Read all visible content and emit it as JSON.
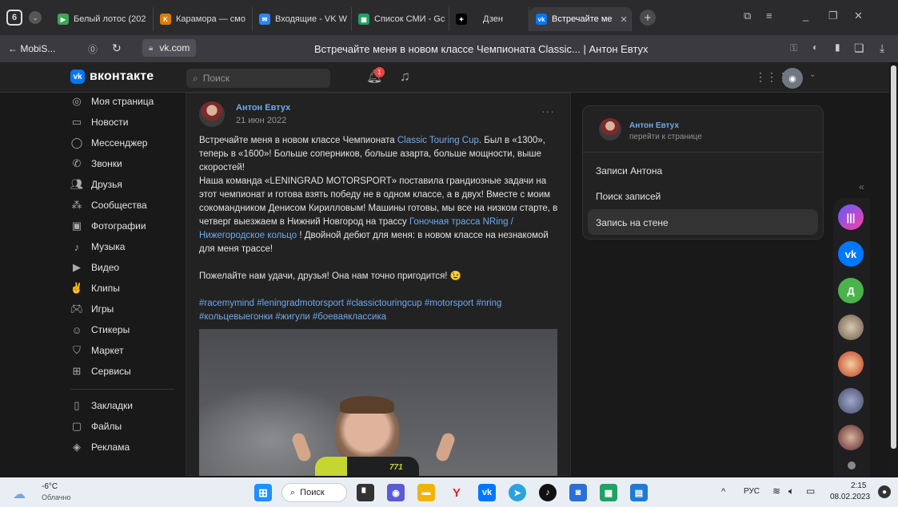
{
  "browser": {
    "workspace_count": "6",
    "tabs": [
      {
        "label": "Белый лотос (202",
        "favicon_color": "#3aa757"
      },
      {
        "label": "Карамора — смо",
        "favicon_color": "#e07b00"
      },
      {
        "label": "Входящие - VK W",
        "favicon_color": "#2787f5"
      },
      {
        "label": "Список СМИ - Gc",
        "favicon_color": "#1ea362"
      },
      {
        "label": "Дзен",
        "favicon_color": "#000000"
      },
      {
        "label": "Встречайте ме",
        "favicon_color": "#0077ff"
      }
    ],
    "back_label": "← MobiS...",
    "url": "vk.com",
    "page_title": "Встречайте меня в новом классе Чемпионата Classic... | Антон Евтух"
  },
  "vk": {
    "logo_text": "вконтакте",
    "search_placeholder": "Поиск",
    "notification_count": "1",
    "accent": "#0077ff",
    "sidebar": [
      {
        "label": "Моя страница",
        "icon": "user-icon"
      },
      {
        "label": "Новости",
        "icon": "news-icon"
      },
      {
        "label": "Мессенджер",
        "icon": "chat-icon"
      },
      {
        "label": "Звонки",
        "icon": "phone-icon"
      },
      {
        "label": "Друзья",
        "icon": "friends-icon"
      },
      {
        "label": "Сообщества",
        "icon": "groups-icon"
      },
      {
        "label": "Фотографии",
        "icon": "photo-icon"
      },
      {
        "label": "Музыка",
        "icon": "music-icon"
      },
      {
        "label": "Видео",
        "icon": "video-icon"
      },
      {
        "label": "Клипы",
        "icon": "clips-icon"
      },
      {
        "label": "Игры",
        "icon": "games-icon"
      },
      {
        "label": "Стикеры",
        "icon": "sticker-icon"
      },
      {
        "label": "Маркет",
        "icon": "market-icon"
      },
      {
        "label": "Сервисы",
        "icon": "services-icon"
      },
      {
        "label": "Закладки",
        "icon": "bookmark-icon"
      },
      {
        "label": "Файлы",
        "icon": "file-icon"
      },
      {
        "label": "Реклама",
        "icon": "ads-icon"
      }
    ],
    "post": {
      "author": "Антон Евтух",
      "date": "21 июн 2022",
      "text1": "Встречайте меня в новом классе Чемпионата ",
      "link1": "Classic Touring Cup",
      "text2": ". Был в «1300», теперь в «1600»! Больше соперников, больше азарта, больше мощности, выше скоростей!",
      "text3": "Наша команда «LENINGRAD MOTORSPORT» поставила грандиозные задачи на этот чемпионат и готова взять победу не в одном классе, а в двух! Вместе с моим сокомандником Денисом Кирилловым! Машины готовы, мы все на низком старте, в четверг выезжаем в Нижний Новгород на трассу ",
      "link2": "Гоночная трасса NRing / Нижегородское кольцо",
      "text4": " ! Двойной дебют для меня: в новом классе на незнакомой для меня трассе!",
      "text5": "Пожелайте нам удачи, друзья! Она нам точно пригодится! 😉",
      "hashtags": "#racemymind #leningradmotorsport #classictouringcup #motorsport #nring #кольцевыегонки #жигули #боеваяклассика",
      "jersey_number": "771"
    },
    "menu": {
      "author": "Антон Евтух",
      "goto": "перейти к странице",
      "items": [
        "Записи Антона",
        "Поиск записей",
        "Запись на стене"
      ]
    },
    "dock_letter": "Д"
  },
  "taskbar": {
    "weather_temp": "-6°C",
    "weather_desc": "Облачно",
    "search_label": "Поиск",
    "lang": "РУС",
    "time": "2:15",
    "date": "08.02.2023"
  }
}
